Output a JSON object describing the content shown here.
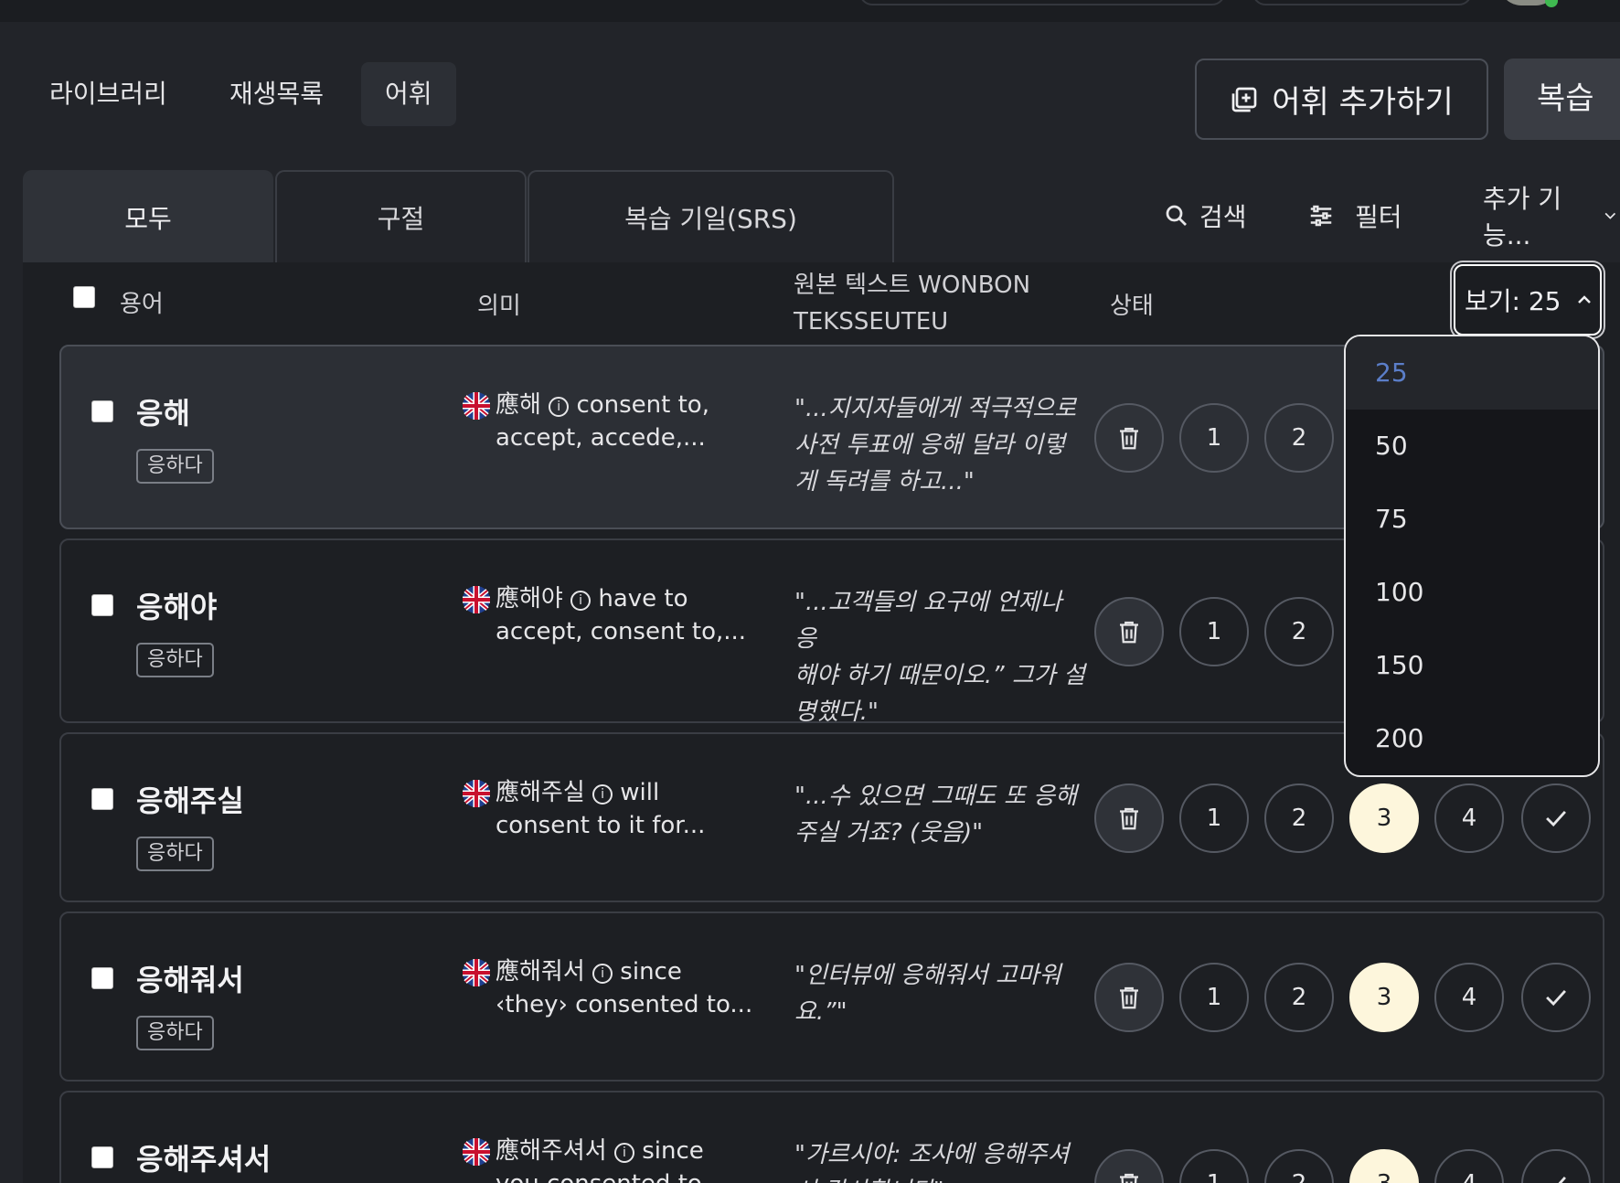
{
  "nav": {
    "items": [
      {
        "label": "라이브러리"
      },
      {
        "label": "재생목록"
      },
      {
        "label": "어휘"
      }
    ],
    "active": "어휘",
    "add_button": "어휘 추가하기",
    "review_button": "복습"
  },
  "subtabs": [
    {
      "label": "모두"
    },
    {
      "label": "구절"
    },
    {
      "label": "복습 기일(SRS)"
    }
  ],
  "tools": {
    "search": "검색",
    "filter": "필터",
    "more": "추가 기능..."
  },
  "table": {
    "headers": {
      "term": "용어",
      "meaning": "의미",
      "source_line1": "원본 텍스트 WONBON",
      "source_line2": "TEKSSEUTEU",
      "status": "상태"
    },
    "per_page": "보기: 25",
    "per_page_options": [
      "25",
      "50",
      "75",
      "100",
      "150",
      "200"
    ],
    "selected_option": "25",
    "rows": [
      {
        "term": "응해",
        "tag": "응하다",
        "hanja": "應해",
        "meaning_l1": "consent to,",
        "meaning_l2": "accept, accede,...",
        "quote_l1": "\"...지지자들에게 적극적으로",
        "quote_l2": "사전 투표에 응해 달라 이렇",
        "quote_l3": "게 독려를 하고...\"",
        "level": null
      },
      {
        "term": "응해야",
        "tag": "응하다",
        "hanja": "應해야",
        "meaning_l1": "have to",
        "meaning_l2": "accept, consent to,...",
        "quote_l1": "\"...고객들의 요구에 언제나 응",
        "quote_l2": "해야 하기 때문이오.” 그가 설",
        "quote_l3": "명했다.\"",
        "level": null
      },
      {
        "term": "응해주실",
        "tag": "응하다",
        "hanja": "應해주실",
        "meaning_l1": "will",
        "meaning_l2": "consent to it for...",
        "quote_l1": "\"...수 있으면 그때도 또 응해",
        "quote_l2": "주실 거죠? (웃음)\"",
        "quote_l3": "",
        "level": 3
      },
      {
        "term": "응해줘서",
        "tag": "응하다",
        "hanja": "應해줘서",
        "meaning_l1": "since",
        "meaning_l2": "‹they› consented to...",
        "quote_l1": "\"인터뷰에 응해줘서 고마워",
        "quote_l2": "요.”\"",
        "quote_l3": "",
        "level": 3
      },
      {
        "term": "응해주셔서",
        "tag": "",
        "hanja": "應해주셔서",
        "meaning_l1": "since",
        "meaning_l2": "you consented to...",
        "quote_l1": "\"가르시아: 조사에 응해주셔",
        "quote_l2": "서 감사합니다\"",
        "quote_l3": "",
        "level": 3
      }
    ]
  },
  "status_buttons": [
    "1",
    "2",
    "3",
    "4"
  ],
  "icons": {
    "add": "add-square-icon",
    "search": "search-icon",
    "filter": "sliders-icon",
    "chevron": "chevron-up-icon",
    "trash": "trash-icon",
    "check": "check-icon",
    "flag": "uk-flag-icon",
    "info": "info-circle-icon"
  },
  "colors": {
    "background": "#222429",
    "selected_level": "#fdf6dc",
    "selected_option_text": "#5b7ec9"
  }
}
